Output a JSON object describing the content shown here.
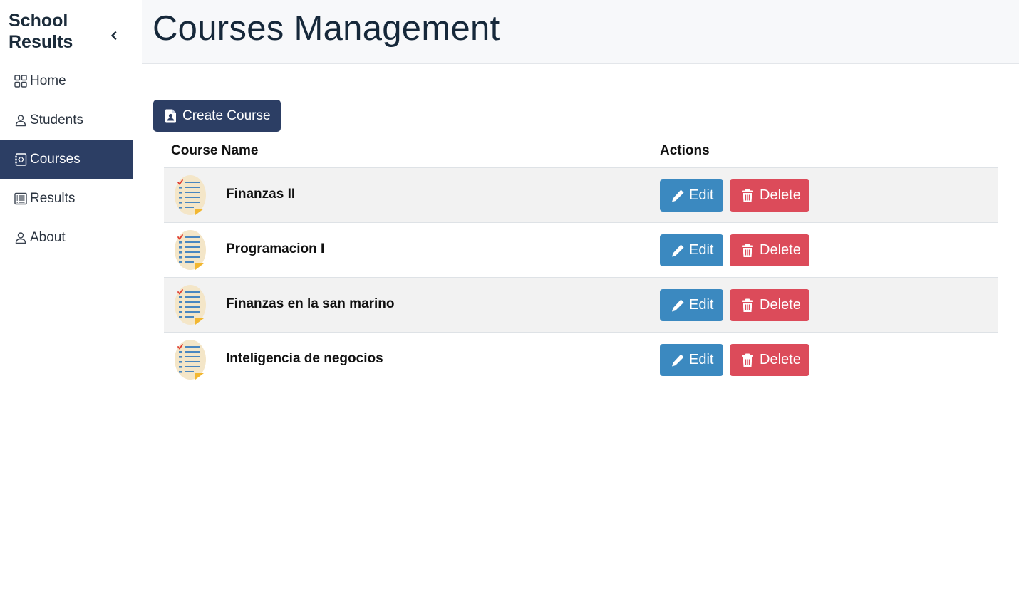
{
  "sidebar": {
    "brand_line1": "School",
    "brand_line2": "Results",
    "collapse_icon": "chevron-left-icon",
    "items": [
      {
        "label": "Home",
        "icon": "grid-icon",
        "active": false
      },
      {
        "label": "Students",
        "icon": "person-icon",
        "active": false
      },
      {
        "label": "Courses",
        "icon": "code-file-icon",
        "active": true
      },
      {
        "label": "Results",
        "icon": "list-icon",
        "active": false
      },
      {
        "label": "About",
        "icon": "person-icon",
        "active": false
      }
    ]
  },
  "header": {
    "title": "Courses Management"
  },
  "toolbar": {
    "create_label": "Create Course",
    "create_icon": "file-person-icon"
  },
  "table": {
    "columns": [
      "Course Name",
      "Actions"
    ],
    "edit_label": "Edit",
    "delete_label": "Delete",
    "rows": [
      {
        "name": "Finanzas II"
      },
      {
        "name": "Programacion I"
      },
      {
        "name": "Finanzas en la san marino"
      },
      {
        "name": "Inteligencia de negocios"
      }
    ]
  },
  "colors": {
    "primary": "#2c3e64",
    "edit": "#3b89c0",
    "delete": "#dc4b5a",
    "header_bg": "#f7f8fa",
    "stripe": "#f2f2f2"
  }
}
